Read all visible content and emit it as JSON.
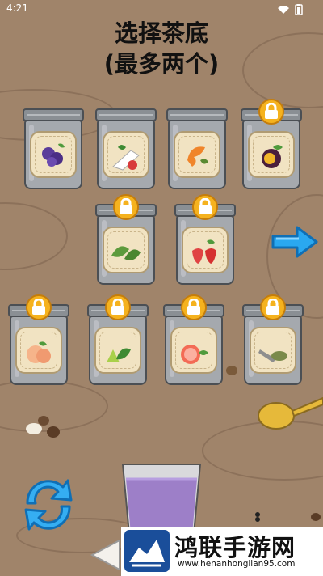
{
  "status_bar": {
    "time": "4:21"
  },
  "title": {
    "line1": "选择茶底",
    "line2": "(最多两个)"
  },
  "jars": [
    {
      "name": "purple-sweet-potato",
      "locked": false
    },
    {
      "name": "strawberry-milk",
      "locked": false
    },
    {
      "name": "shrimp",
      "locked": false
    },
    {
      "name": "passion-fruit",
      "locked": true
    },
    {
      "name": "tea-leaves",
      "locked": true
    },
    {
      "name": "strawberry",
      "locked": true
    },
    {
      "name": "peach",
      "locked": true
    },
    {
      "name": "green-pear",
      "locked": true
    },
    {
      "name": "grapefruit",
      "locked": true
    },
    {
      "name": "matcha-powder",
      "locked": true
    }
  ],
  "watermark": {
    "name": "鸿联手游网",
    "url": "www.henanhonglian95.com"
  },
  "colors": {
    "background": "#a0846a",
    "lock": "#f5b21e",
    "arrow": "#2aa8f0",
    "cup_drink": "#9d7fc8"
  }
}
